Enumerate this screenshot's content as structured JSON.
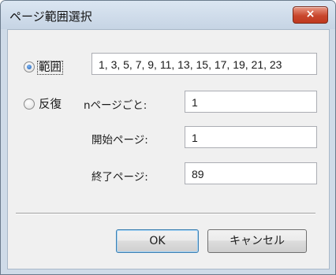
{
  "window": {
    "title": "ページ範囲選択",
    "close_label": "×"
  },
  "options": {
    "range": {
      "label": "範囲",
      "selected": true,
      "value": "1, 3, 5, 7, 9, 11, 13, 15, 17, 19, 21, 23"
    },
    "repeat": {
      "label": "反復",
      "selected": false,
      "every_n_label": "nページごと:",
      "every_n_value": "1",
      "start_label": "開始ページ:",
      "start_value": "1",
      "end_label": "終了ページ:",
      "end_value": "89"
    }
  },
  "buttons": {
    "ok": "OK",
    "cancel": "キャンセル"
  }
}
